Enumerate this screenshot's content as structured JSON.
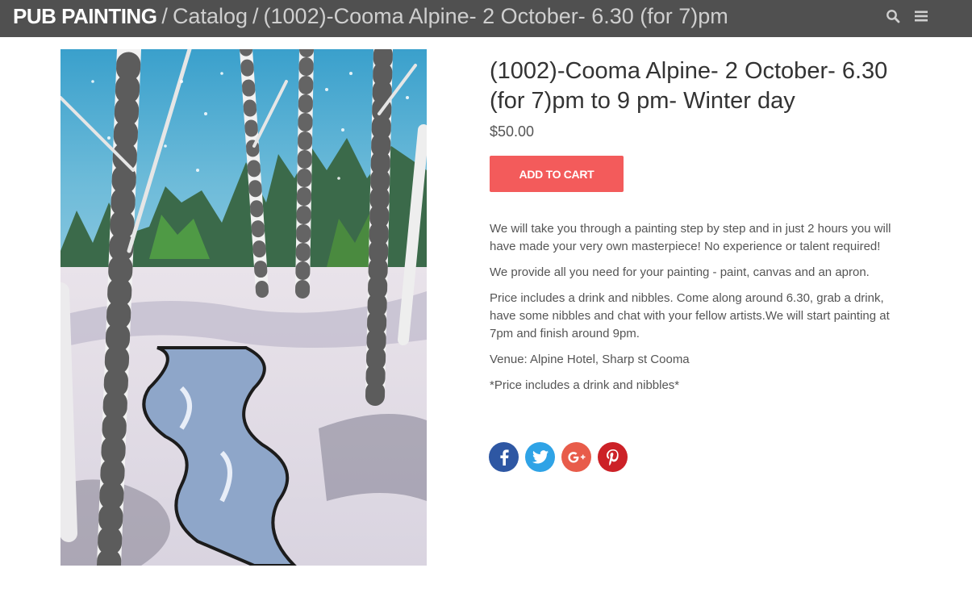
{
  "header": {
    "brand": "PUB PAINTING",
    "separator1": "/",
    "catalog": "Catalog",
    "separator2": "/",
    "current": "(1002)-Cooma Alpine- 2 October- 6.30 (for 7)pm",
    "icons": [
      "search-icon",
      "menu-icon"
    ]
  },
  "product": {
    "image_alt": "winter birch trees painting",
    "title": "(1002)-Cooma Alpine- 2 October- 6.30 (for 7)pm to 9 pm- Winter day",
    "price": "$50.00",
    "add_to_cart": "ADD TO CART",
    "description": [
      "We will take you through a painting step by step and in just 2 hours you will have made your very own masterpiece! No experience or talent required!",
      "We provide all you need for your painting - paint, canvas and an apron.",
      "Price includes a drink and nibbles. Come along around 6.30, grab a drink, have some nibbles and chat with your fellow artists.We will start painting at 7pm and finish around 9pm.",
      "Venue: Alpine Hotel, Sharp st Cooma",
      "*Price includes a drink and nibbles*"
    ]
  },
  "social": {
    "icons": [
      "facebook-icon",
      "twitter-icon",
      "google-plus-icon",
      "pinterest-icon"
    ],
    "colors": {
      "facebook": "#2e57a3",
      "twitter": "#2fa3e6",
      "google_plus": "#e85c4a",
      "pinterest": "#cc2127"
    }
  },
  "colors": {
    "topbar": "#505050",
    "accent_button": "#f35b5b"
  }
}
